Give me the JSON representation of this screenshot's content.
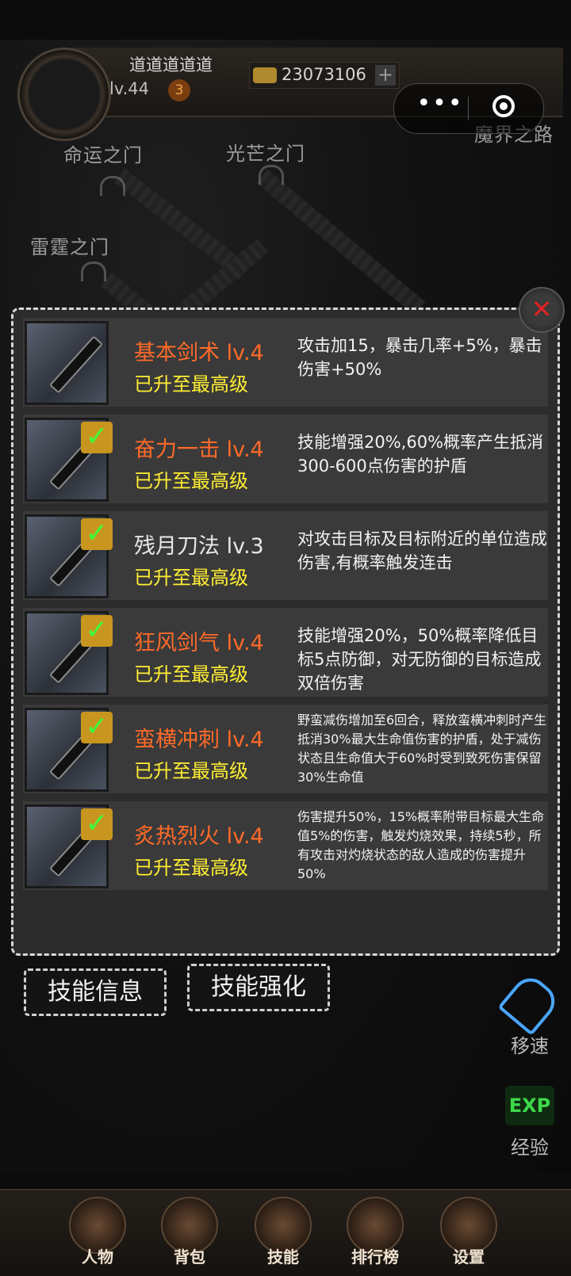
{
  "header": {
    "player_name": "道道道道道",
    "level": "lv.44",
    "level_badge": "3",
    "gold": "23073106",
    "gold_add": "+"
  },
  "map": {
    "locations": [
      "命运之门",
      "光芒之门",
      "雷霆之门",
      "魔界之路"
    ]
  },
  "capsule": {
    "more": "•••"
  },
  "panel": {
    "close": "✕",
    "skills": [
      {
        "name": "基本剑术 lv.4",
        "status": "已升至最高级",
        "desc": "攻击加15，暴击几率+5%，暴击伤害+50%",
        "checked": false,
        "name_color": "#ff6a28"
      },
      {
        "name": "奋力一击 lv.4",
        "status": "已升至最高级",
        "desc": "技能增强20%,60%概率产生抵消300-600点伤害的护盾",
        "checked": true,
        "name_color": "#ff6a28"
      },
      {
        "name": "残月刀法 lv.3",
        "status": "已升至最高级",
        "desc": "对攻击目标及目标附近的单位造成伤害,有概率触发连击",
        "checked": true,
        "name_color": "#e8e8e8"
      },
      {
        "name": "狂风剑气 lv.4",
        "status": "已升至最高级",
        "desc": "技能增强20%，50%概率降低目标5点防御，对无防御的目标造成双倍伤害",
        "checked": true,
        "name_color": "#ff6a28"
      },
      {
        "name": "蛮横冲刺 lv.4",
        "status": "已升至最高级",
        "desc": "野蛮减伤增加至6回合，释放蛮横冲刺时产生抵消30%最大生命值伤害的护盾，处于减伤状态且生命值大于60%时受到致死伤害保留30%生命值",
        "checked": true,
        "name_color": "#ff6a28"
      },
      {
        "name": "炙热烈火 lv.4",
        "status": "已升至最高级",
        "desc": "伤害提升50%，15%概率附带目标最大生命值5%的伤害，触发灼烧效果，持续5秒，所有攻击对灼烧状态的敌人造成的伤害提升50%",
        "checked": true,
        "name_color": "#ff6a28"
      }
    ]
  },
  "tabs": {
    "info": "技能信息",
    "enhance": "技能强化"
  },
  "side": {
    "speed": "移速",
    "exp_icon": "EXP",
    "exp": "经验"
  },
  "nav": [
    "人物",
    "背包",
    "技能",
    "排行榜",
    "设置"
  ],
  "check_glyph": "✓"
}
